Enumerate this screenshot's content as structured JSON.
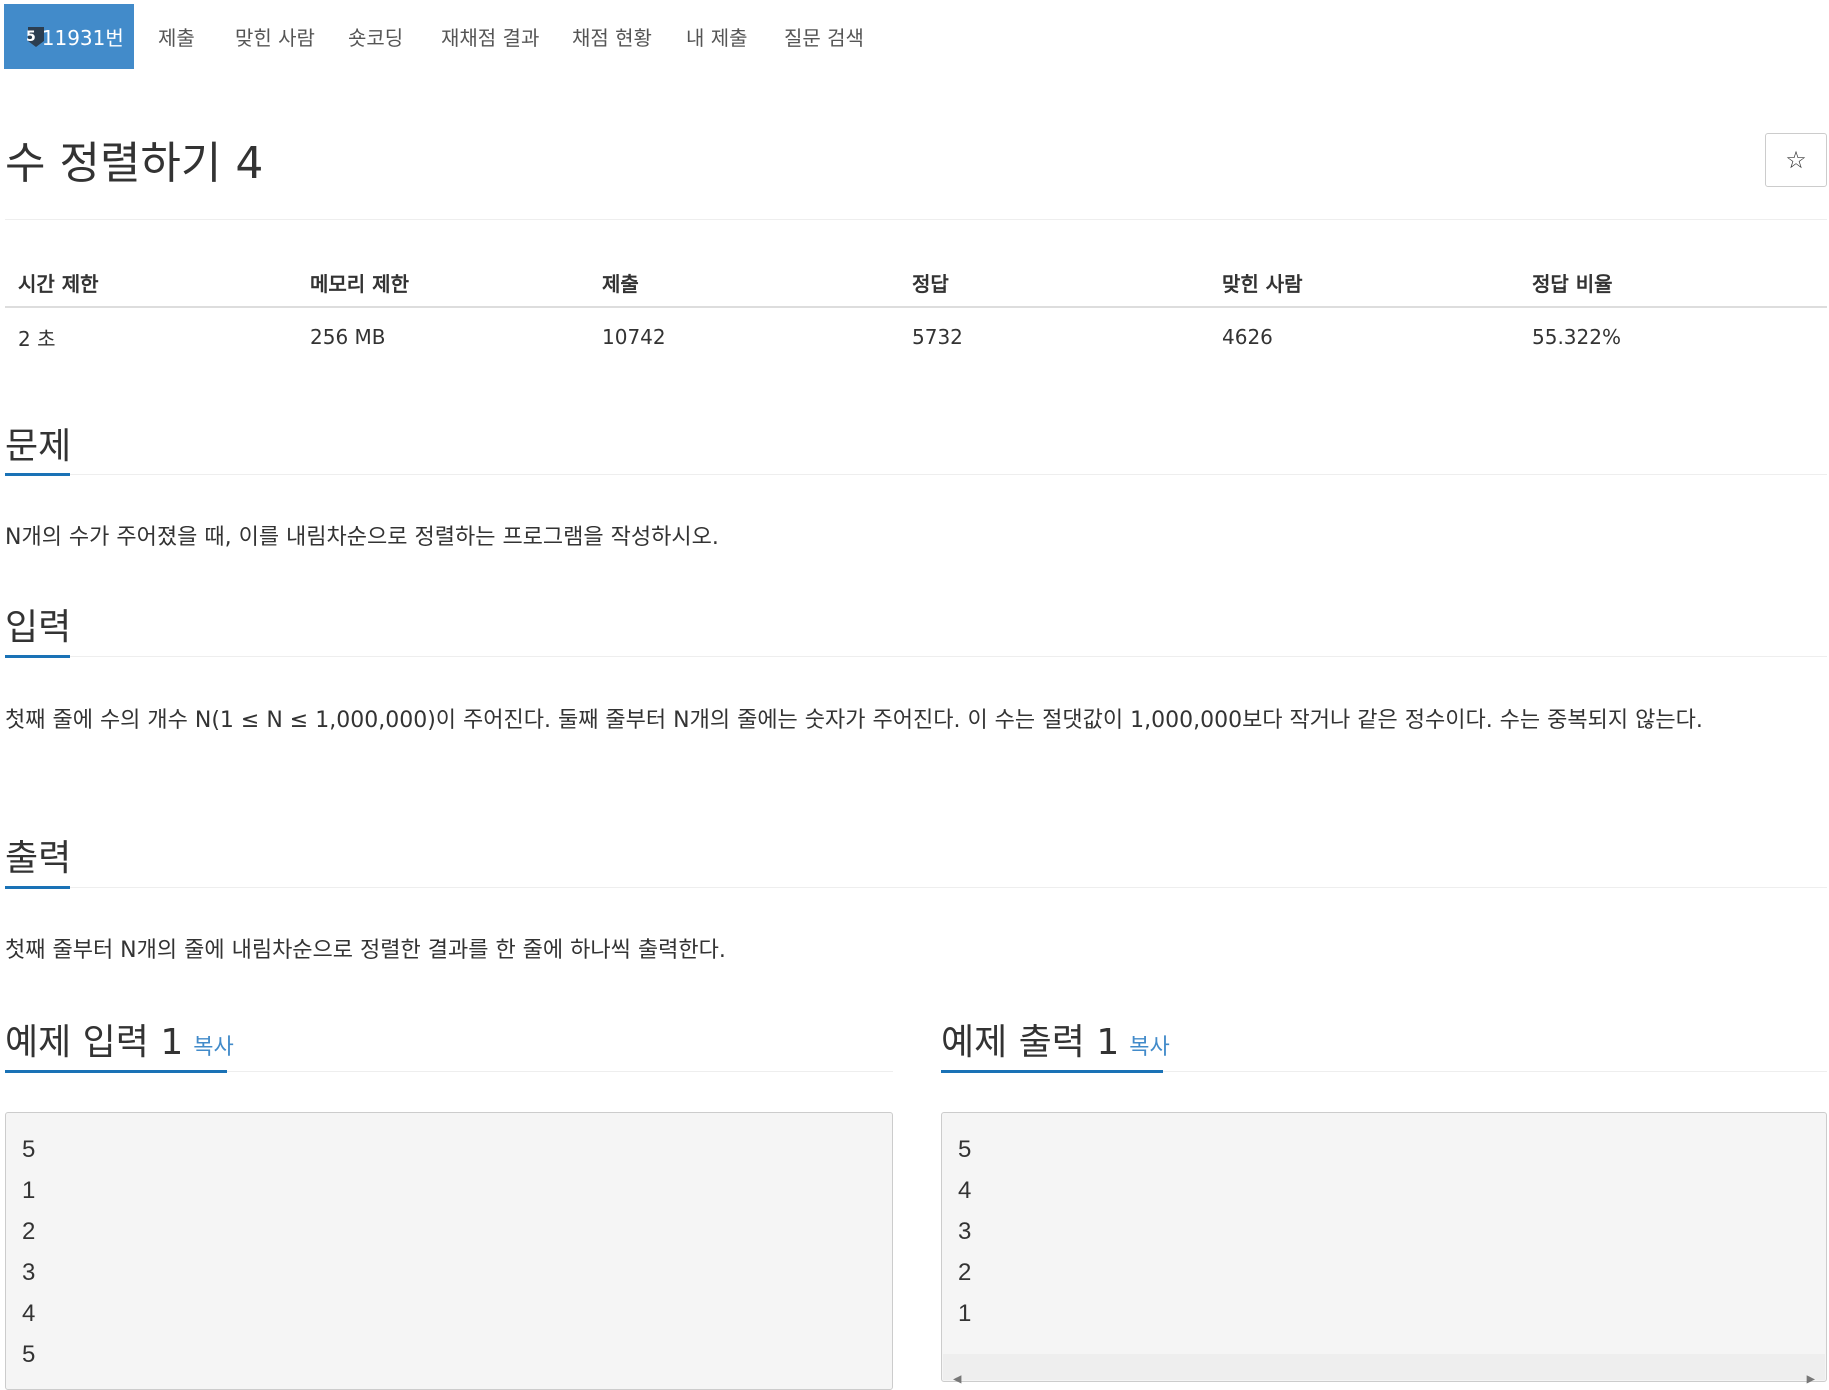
{
  "nav": {
    "problem_tier": "5",
    "problem_id_label": "11931번",
    "tabs": [
      "제출",
      "맞힌 사람",
      "숏코딩",
      "재채점 결과",
      "채점 현황",
      "내 제출",
      "질문 검색"
    ]
  },
  "title": "수 정렬하기 4",
  "star_icon": "☆",
  "info": {
    "headers": [
      "시간 제한",
      "메모리 제한",
      "제출",
      "정답",
      "맞힌 사람",
      "정답 비율"
    ],
    "values": [
      "2 초",
      "256 MB",
      "10742",
      "5732",
      "4626",
      "55.322%"
    ]
  },
  "sections": {
    "problem": {
      "heading": "문제",
      "text": "N개의 수가 주어졌을 때, 이를 내림차순으로 정렬하는 프로그램을 작성하시오."
    },
    "input": {
      "heading": "입력",
      "text": "첫째 줄에 수의 개수 N(1 ≤ N ≤ 1,000,000)이 주어진다. 둘째 줄부터 N개의 줄에는 숫자가 주어진다. 이 수는 절댓값이 1,000,000보다 작거나 같은 정수이다. 수는 중복되지 않는다."
    },
    "output": {
      "heading": "출력",
      "text": "첫째 줄부터 N개의 줄에 내림차순으로 정렬한 결과를 한 줄에 하나씩 출력한다."
    }
  },
  "samples": {
    "input": {
      "heading": "예제 입력 1",
      "copy_label": "복사",
      "lines": [
        "5",
        "1",
        "2",
        "3",
        "4",
        "5"
      ]
    },
    "output": {
      "heading": "예제 출력 1",
      "copy_label": "복사",
      "lines": [
        "5",
        "4",
        "3",
        "2",
        "1"
      ]
    }
  },
  "colors": {
    "accent": "#428bca",
    "section_underline": "#1a72b6",
    "tier_badge": "#2c3e50"
  }
}
